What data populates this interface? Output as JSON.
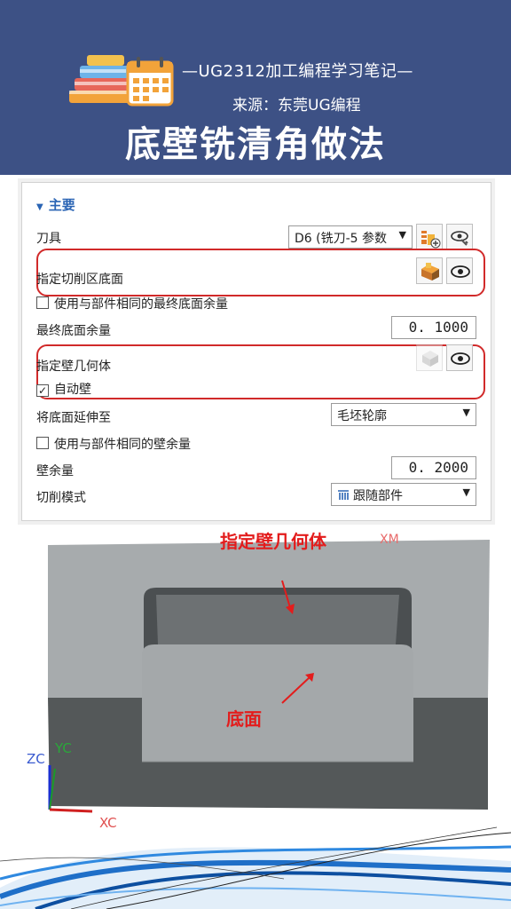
{
  "header": {
    "subtitle": "—UG2312加工编程学习笔记—",
    "source": "来源：东莞UG编程",
    "title": "底壁铣清角做法"
  },
  "panel": {
    "section_label": "主要",
    "tool_label": "刀具",
    "tool_value": "D6 (铣刀-5 参数",
    "cut_area_label": "指定切削区底面",
    "use_same_floor_stock_label": "使用与部件相同的最终底面余量",
    "final_floor_stock_label": "最终底面余量",
    "final_floor_stock_value": "0. 1000",
    "wall_geometry_label": "指定壁几何体",
    "auto_wall_label": "自动壁",
    "extend_floor_label": "将底面延伸至",
    "extend_floor_value": "毛坯轮廓",
    "use_same_wall_stock_label": "使用与部件相同的壁余量",
    "wall_stock_label": "壁余量",
    "wall_stock_value": "0. 2000",
    "cut_pattern_label": "切削模式",
    "cut_pattern_value": "跟随部件"
  },
  "viewport": {
    "wall_annotation": "指定壁几何体",
    "floor_annotation": "底面",
    "faded_label": "XM",
    "axis_zc": "ZC",
    "axis_yc": "YC",
    "axis_xc": "XC"
  },
  "colors": {
    "header_bg": "#3d5185",
    "annotation_red": "#e31c1c",
    "highlight_box": "#d12a2a"
  }
}
